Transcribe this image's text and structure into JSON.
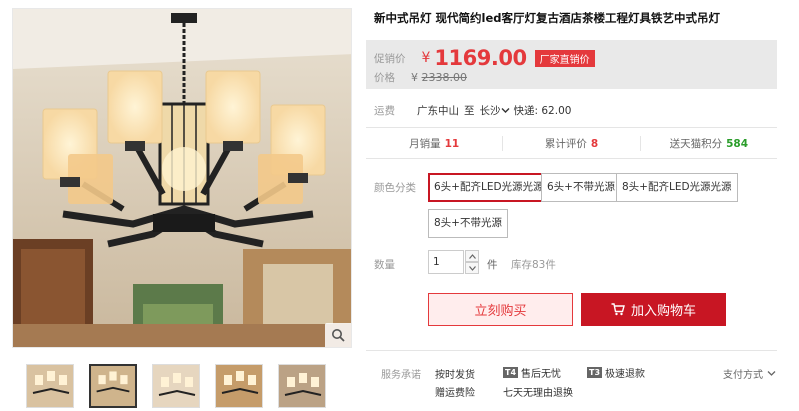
{
  "product": {
    "title": "新中式吊灯 现代简约led客厅灯复古酒店茶楼工程灯具铁艺中式吊灯"
  },
  "price": {
    "promo_label": "促销价",
    "currency": "¥",
    "promo_price": "1169.00",
    "badge": "厂家直销价",
    "orig_label": "价格",
    "orig_price": "2338.00"
  },
  "shipping": {
    "label": "运费",
    "from": "广东中山",
    "to_word": "至",
    "to": "长沙",
    "fee": "快递: 62.00"
  },
  "stats": {
    "monthly_sales_label": "月销量",
    "monthly_sales": "11",
    "reviews_label": "累计评价",
    "reviews": "8",
    "points_label": "送天猫积分",
    "points": "584"
  },
  "options": {
    "color_label": "颜色分类",
    "items": [
      "6头+配齐LED光源光源",
      "6头+不带光源",
      "8头+配齐LED光源光源",
      "8头+不带光源"
    ],
    "selected_index": 0
  },
  "quantity": {
    "label": "数量",
    "value": "1",
    "unit": "件",
    "stock": "库存83件"
  },
  "buttons": {
    "buy_now": "立刻购买",
    "add_to_cart": "加入购物车"
  },
  "services": {
    "label": "服务承诺",
    "items": [
      "按时发货",
      "售后无忧",
      "极速退款",
      "赠运费险",
      "七天无理由退换"
    ],
    "badge_t4": "T4",
    "badge_t3": "T3",
    "payment": "支付方式"
  },
  "colors": {
    "accent_red": "#e4393c",
    "cart_red": "#c81623",
    "points_green": "#2a9d2a"
  }
}
